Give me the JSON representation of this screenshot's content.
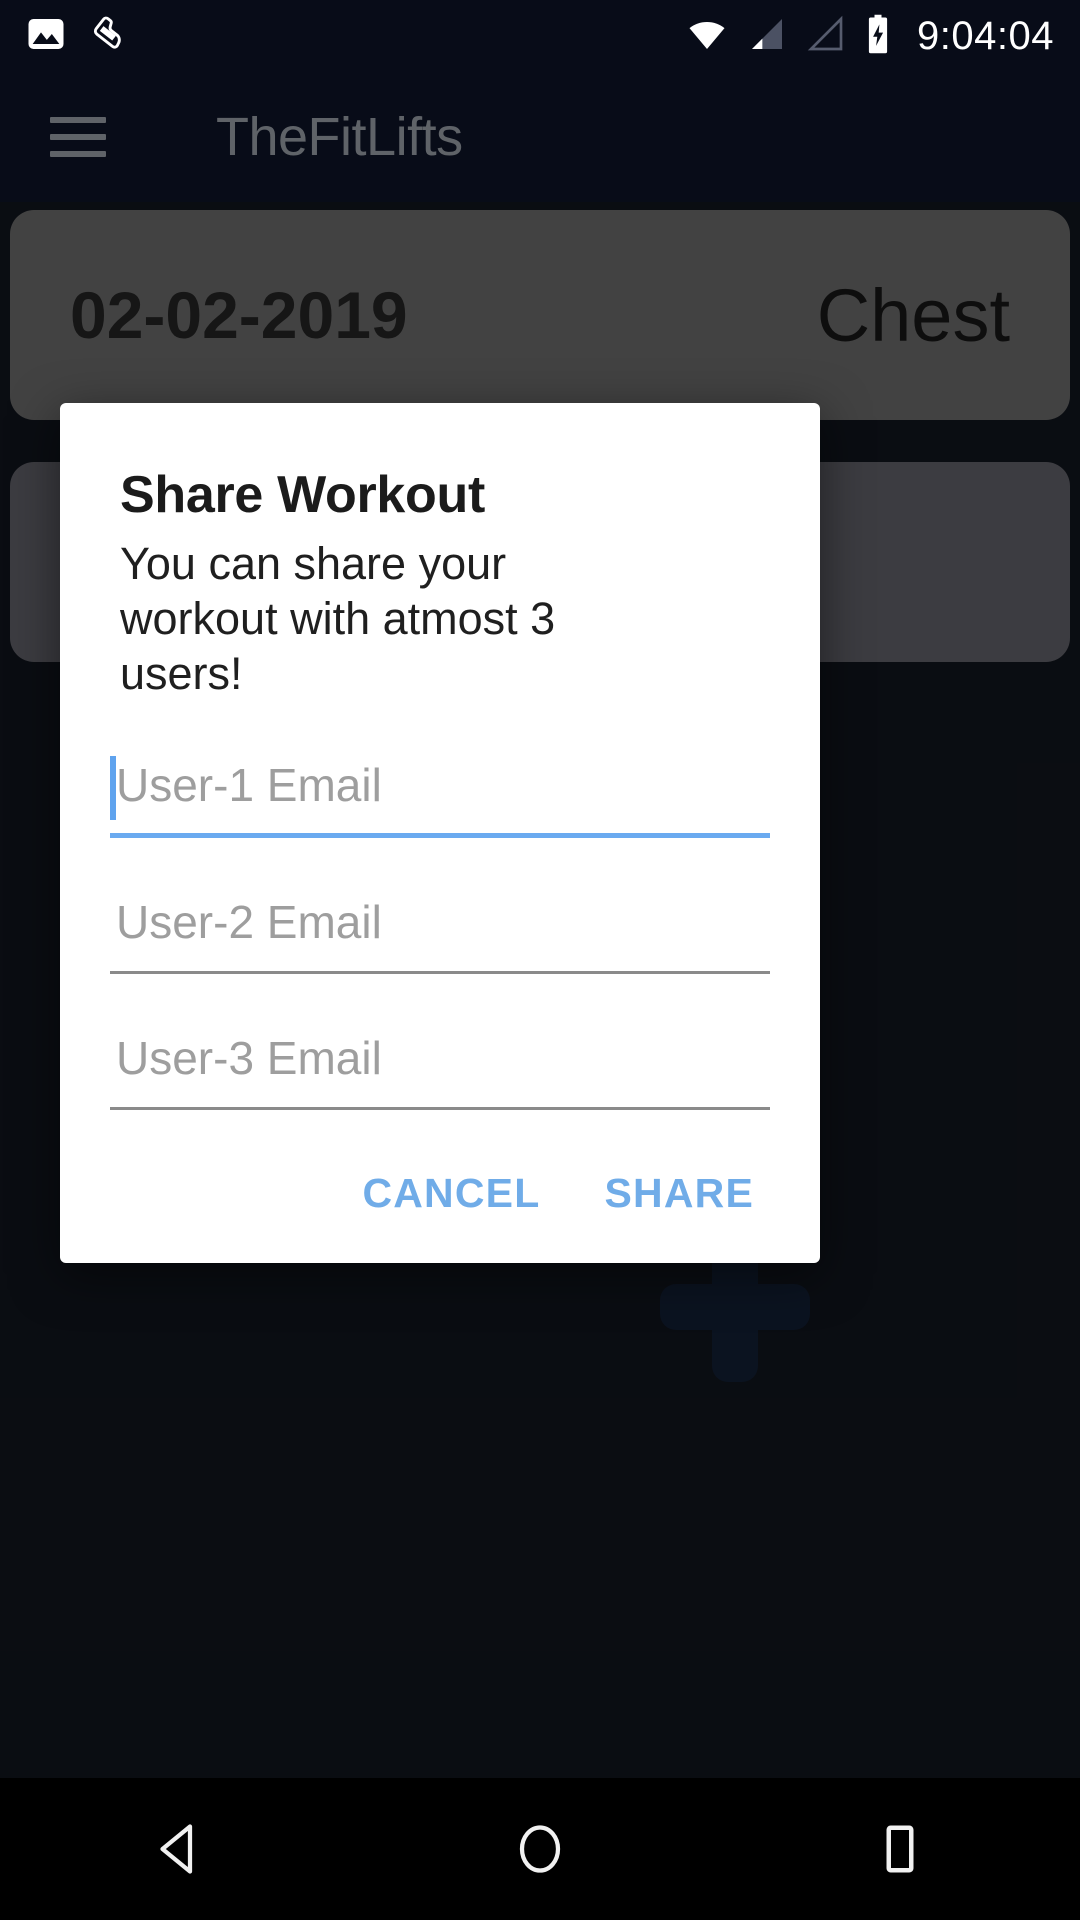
{
  "status_bar": {
    "time": "9:04:04",
    "left_icons": [
      "photo-icon",
      "shoe-icon"
    ],
    "right_icons": [
      "wifi-icon",
      "signal-bars-icon",
      "signal-bars-empty-icon",
      "battery-charging-icon"
    ]
  },
  "app_bar": {
    "menu_icon": "hamburger-menu-icon",
    "title": "TheFitLifts",
    "title_color": "#5f6368"
  },
  "content": {
    "cards": [
      {
        "date": "02-02-2019",
        "name": "Chest"
      },
      {
        "date": "",
        "name": ""
      }
    ],
    "fab": {
      "icon": "plus-icon",
      "color": "#16233b"
    }
  },
  "dialog": {
    "title": "Share Workout",
    "message": "You can share your workout with atmost 3 users!",
    "fields": [
      {
        "placeholder": "User-1 Email",
        "value": "",
        "focused": true
      },
      {
        "placeholder": "User-2 Email",
        "value": "",
        "focused": false
      },
      {
        "placeholder": "User-3 Email",
        "value": "",
        "focused": false
      }
    ],
    "cancel_label": "CANCEL",
    "share_label": "SHARE",
    "accent_color": "#70ace8"
  },
  "nav_bar": {
    "back_label": "back-icon",
    "home_label": "home-icon",
    "recents_label": "recents-icon"
  }
}
